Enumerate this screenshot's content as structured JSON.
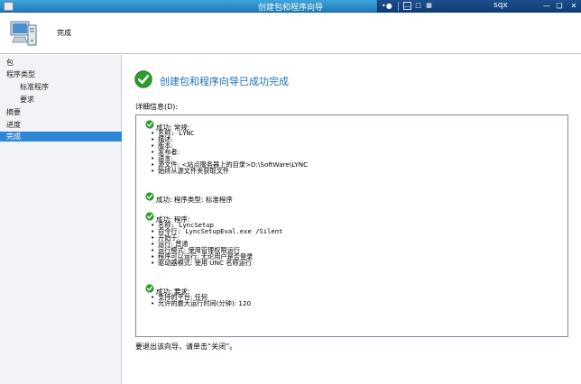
{
  "window": {
    "title": "创建包和程序向导",
    "rdp_host": "sqx"
  },
  "header": {
    "heading": "完成"
  },
  "sidebar": {
    "items": [
      {
        "label": "包",
        "level": 0,
        "active": false
      },
      {
        "label": "程序类型",
        "level": 0,
        "active": false
      },
      {
        "label": "标准程序",
        "level": 1,
        "active": false
      },
      {
        "label": "要求",
        "level": 1,
        "active": false
      },
      {
        "label": "摘要",
        "level": 0,
        "active": false
      },
      {
        "label": "进度",
        "level": 0,
        "active": false
      },
      {
        "label": "完成",
        "level": 0,
        "active": true
      }
    ]
  },
  "main": {
    "headline": "创建包和程序向导已成功完成",
    "details_label": "详细信息(D):",
    "groups": [
      {
        "title": "成功: 常规:",
        "items": [
          "名称: LYNC",
          "描述:",
          "版本:",
          "发布者:",
          "语言:",
          "源文件: <站点服务器上的目录>D:\\SoftWare\\LYNC",
          "始终从源文件夹获取文件"
        ]
      },
      {
        "title": "成功: 程序类型: 标准程序",
        "items": []
      },
      {
        "title": "成功: 程序:",
        "items": [
          "名称: LyncSetup",
          "命令行: LyncSetupEval.exe /Silent",
          "开始于:",
          "运行: 普通",
          "运行模式: 使用管理权限运行",
          "程序可以运行: 无论用户是否登录",
          "驱动器模式: 使用 UNC 名称运行"
        ]
      },
      {
        "title": "成功: 要求:",
        "items": [
          "支持的平台: 任何",
          "允许的最大运行时间(分钟): 120"
        ]
      }
    ],
    "footer_text": "要退出该向导，请单击“关闭”。"
  },
  "colors": {
    "titlebar": "#2b8fcb",
    "selection": "#2f86d6",
    "headline": "#1d6fb3",
    "success_green": "#2e9b2e"
  }
}
